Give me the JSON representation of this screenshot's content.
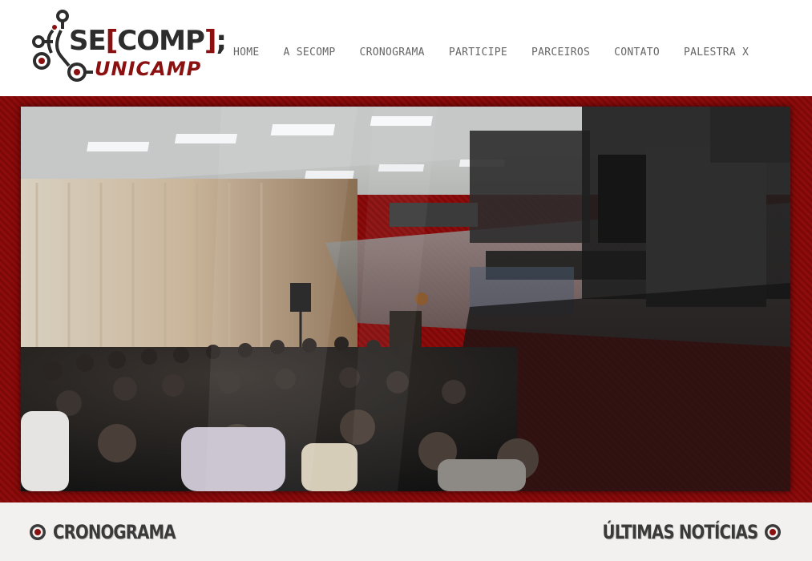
{
  "logo": {
    "text_left": "SE",
    "text_bracket_open": "[",
    "text_comp": "COMP",
    "text_bracket_close": "]",
    "text_semicolon": ";",
    "subtext": "UNICAMP"
  },
  "nav": {
    "items": [
      {
        "label": "HOME"
      },
      {
        "label": "A SECOMP"
      },
      {
        "label": "CRONOGRAMA"
      },
      {
        "label": "PARTICIPE"
      },
      {
        "label": "PARCEIROS"
      },
      {
        "label": "CONTATO"
      },
      {
        "label": "PALESTRA X"
      }
    ]
  },
  "hero": {
    "image_icon": "hero-photo-conference-icon"
  },
  "sections": {
    "left_title": "CRONOGRAMA",
    "right_title": "ÚLTIMAS NOTÍCIAS"
  },
  "colors": {
    "brand_red": "#8b1010",
    "text_dark": "#3a3a3a",
    "nav_gray": "#666666",
    "background": "#f2f1ef"
  }
}
